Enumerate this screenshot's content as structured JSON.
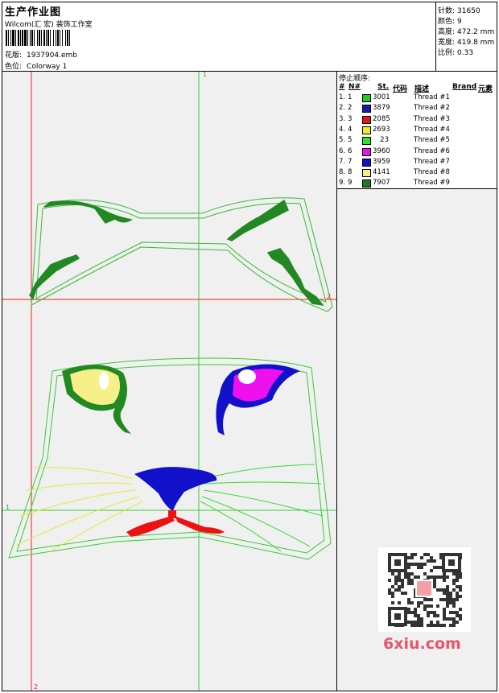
{
  "header": {
    "title": "生产作业图",
    "company": "Wilcom(汇 宏) 装饰工作室",
    "design_label": "花版:",
    "design_value": "1937904.emb",
    "colorway_label": "色位:",
    "colorway_value": "Colorway 1"
  },
  "stats": [
    {
      "label": "针数:",
      "value": "31650"
    },
    {
      "label": "颜色:",
      "value": "9"
    },
    {
      "label": "高度:",
      "value": "472.2 mm"
    },
    {
      "label": "宽度:",
      "value": "419.8 mm"
    },
    {
      "label": "比例:",
      "value": "0.33"
    }
  ],
  "thread_table": {
    "title": "停止顺序:",
    "headers": {
      "hash": "#",
      "n": "N#",
      "st": "St.",
      "code": "代码",
      "desc": "描述",
      "brand": "Brand",
      "elem": "元素"
    },
    "rows": [
      {
        "num": "1.",
        "n": "1",
        "code": "3001",
        "desc": "Thread #1",
        "color": "#22cc22"
      },
      {
        "num": "2.",
        "n": "2",
        "code": "3879",
        "desc": "Thread #2",
        "color": "#1a1aaa"
      },
      {
        "num": "3.",
        "n": "3",
        "code": "2085",
        "desc": "Thread #3",
        "color": "#ee1111"
      },
      {
        "num": "4.",
        "n": "4",
        "code": "2693",
        "desc": "Thread #4",
        "color": "#eeee22"
      },
      {
        "num": "5.",
        "n": "5",
        "code": "23",
        "desc": "Thread #5",
        "color": "#33dd33"
      },
      {
        "num": "6.",
        "n": "6",
        "code": "3960",
        "desc": "Thread #6",
        "color": "#ee11ee"
      },
      {
        "num": "7.",
        "n": "7",
        "code": "3959",
        "desc": "Thread #7",
        "color": "#1111cc"
      },
      {
        "num": "8.",
        "n": "8",
        "code": "4141",
        "desc": "Thread #8",
        "color": "#f5f08a"
      },
      {
        "num": "9.",
        "n": "9",
        "code": "7907",
        "desc": "Thread #9",
        "color": "#227722"
      }
    ]
  },
  "axis_labels": {
    "top_green": "1",
    "right_red": "2",
    "left_green": "1",
    "bottom_red": "2"
  },
  "watermark": "6xiu.com",
  "colors": {
    "guide_green": "#33cc33",
    "guide_red": "#ee2222",
    "canvas_bg": "#f0f0f0",
    "watermark": "#e8556a"
  }
}
